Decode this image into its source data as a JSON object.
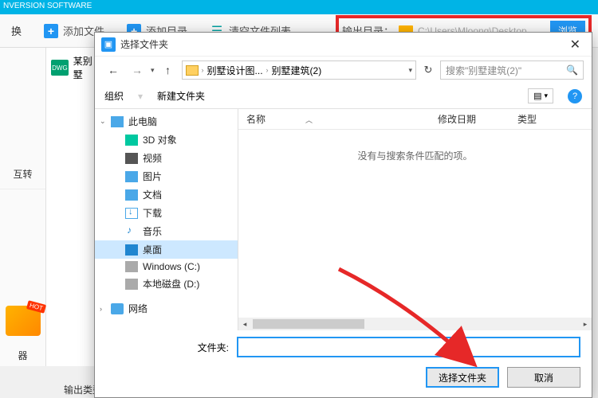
{
  "titleBar": "NVERSION SOFTWARE",
  "toolbar": {
    "convert": "换",
    "addFile": "添加文件",
    "addDir": "添加目录",
    "clearList": "清空文件列表",
    "outputLabel": "输出目录：",
    "outputPath": "C:\\Users\\Mloong\\Desktop",
    "browse": "浏览"
  },
  "sidebar": {
    "mutual": "互转",
    "device": "器"
  },
  "fileList": {
    "item1": "某别墅",
    "dwg": "DWG"
  },
  "bottomLabel": "输出类型",
  "dialog": {
    "title": "选择文件夹",
    "breadcrumb1": "别墅设计图...",
    "breadcrumb2": "别墅建筑(2)",
    "searchPlaceholder": "搜索\"别墅建筑(2)\"",
    "organize": "组织",
    "newFolder": "新建文件夹",
    "tree": {
      "pc": "此电脑",
      "obj3d": "3D 对象",
      "video": "视频",
      "pic": "图片",
      "doc": "文档",
      "dl": "下载",
      "music": "音乐",
      "desktop": "桌面",
      "cdrive": "Windows (C:)",
      "ddrive": "本地磁盘 (D:)",
      "network": "网络"
    },
    "cols": {
      "name": "名称",
      "date": "修改日期",
      "type": "类型"
    },
    "emptyMsg": "没有与搜索条件匹配的项。",
    "folderLabel": "文件夹:",
    "folderValue": "",
    "selectBtn": "选择文件夹",
    "cancelBtn": "取消"
  }
}
